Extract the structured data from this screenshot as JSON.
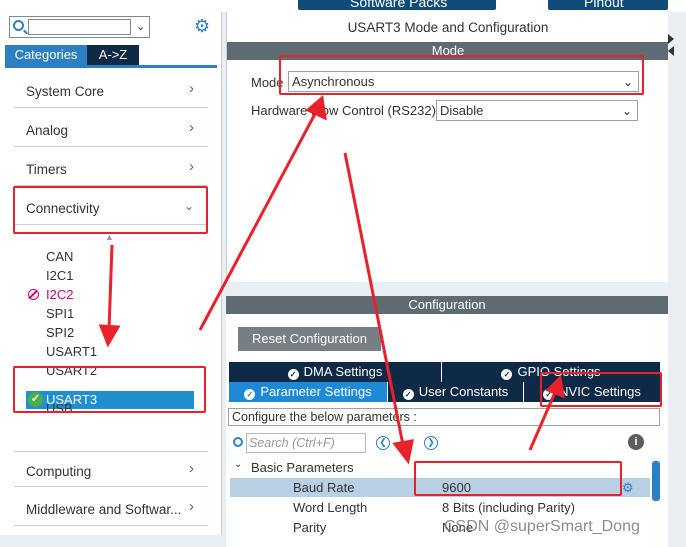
{
  "topbar": {
    "software_packs": "Software Packs",
    "pinout": "Pinout"
  },
  "left": {
    "tabs": [
      "Categories",
      "A->Z"
    ],
    "categories": [
      {
        "label": "System Core",
        "arrow": ">"
      },
      {
        "label": "Analog",
        "arrow": ">"
      },
      {
        "label": "Timers",
        "arrow": ">"
      },
      {
        "label": "Connectivity",
        "arrow": "v"
      }
    ],
    "peripherals": [
      "CAN",
      "I2C1",
      "I2C2",
      "SPI1",
      "SPI2",
      "USART1",
      "USART2",
      "USART3",
      "USB"
    ],
    "bottom_categories": [
      {
        "label": "Computing",
        "arrow": ">"
      },
      {
        "label": "Middleware and Softwar...",
        "arrow": ">"
      }
    ]
  },
  "mode_panel": {
    "title": "USART3 Mode and Configuration",
    "header": "Mode",
    "mode_label": "Mode",
    "mode_value": "Asynchronous",
    "hfc_label": "Hardware Flow Control (RS232)",
    "hfc_value": "Disable"
  },
  "config_panel": {
    "header": "Configuration",
    "reset_button": "Reset Configuration",
    "tabs_row1": [
      "DMA Settings",
      "GPIO Settings"
    ],
    "tabs_row2": [
      "Parameter Settings",
      "User Constants",
      "NVIC Settings"
    ],
    "hint": "Configure the below parameters :",
    "search_placeholder": "Search (Ctrl+F)",
    "group": "Basic Parameters",
    "params": [
      {
        "name": "Baud Rate",
        "value": "9600"
      },
      {
        "name": "Word Length",
        "value": "8 Bits (including Parity)"
      },
      {
        "name": "Parity",
        "value": "None"
      }
    ]
  },
  "watermark": "CSDN @superSmart_Dong",
  "colors": {
    "accent": "#1e8ad6",
    "navy": "#0e2a47",
    "header_gray": "#5f6b73",
    "annotation_red": "#e8212a",
    "error_pink": "#d6006a",
    "ok_green": "#48b04a"
  }
}
